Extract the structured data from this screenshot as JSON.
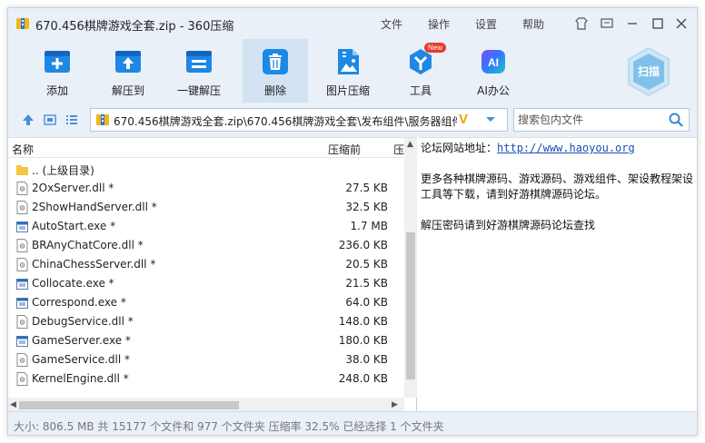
{
  "window": {
    "title": "670.456棋牌游戏全套.zip - 360压缩",
    "menus": [
      "文件",
      "操作",
      "设置",
      "帮助"
    ]
  },
  "toolbar": {
    "items": [
      {
        "label": "添加",
        "icon": "add-icon"
      },
      {
        "label": "解压到",
        "icon": "extract-to-icon"
      },
      {
        "label": "一键解压",
        "icon": "one-click-extract-icon"
      },
      {
        "label": "删除",
        "icon": "delete-icon"
      },
      {
        "label": "图片压缩",
        "icon": "image-compress-icon"
      },
      {
        "label": "工具",
        "icon": "tools-icon",
        "badge": "New"
      },
      {
        "label": "AI办公",
        "icon": "ai-office-icon"
      }
    ],
    "scan_label": "扫描"
  },
  "address": {
    "path": "670.456棋牌游戏全套.zip\\670.456棋牌游戏全套\\发布组件\\服务器组件\\F",
    "search_placeholder": "搜索包内文件"
  },
  "list": {
    "columns": {
      "name": "名称",
      "size": "压缩前",
      "packed": "压"
    },
    "rows": [
      {
        "name": ".. (上级目录)",
        "size": "",
        "type": "folder"
      },
      {
        "name": "2OxServer.dll *",
        "size": "27.5 KB",
        "type": "dll"
      },
      {
        "name": "2ShowHandServer.dll *",
        "size": "32.5 KB",
        "type": "dll"
      },
      {
        "name": "AutoStart.exe *",
        "size": "1.7 MB",
        "type": "exe"
      },
      {
        "name": "BRAnyChatCore.dll *",
        "size": "236.0 KB",
        "type": "dll"
      },
      {
        "name": "ChinaChessServer.dll *",
        "size": "20.5 KB",
        "type": "dll"
      },
      {
        "name": "Collocate.exe *",
        "size": "21.5 KB",
        "type": "exe"
      },
      {
        "name": "Correspond.exe *",
        "size": "64.0 KB",
        "type": "exe"
      },
      {
        "name": "DebugService.dll *",
        "size": "148.0 KB",
        "type": "dll"
      },
      {
        "name": "GameServer.exe *",
        "size": "180.0 KB",
        "type": "exe"
      },
      {
        "name": "GameService.dll *",
        "size": "38.0 KB",
        "type": "dll"
      },
      {
        "name": "KernelEngine.dll *",
        "size": "248.0 KB",
        "type": "dll"
      }
    ]
  },
  "comment": {
    "line1_label": "论坛网站地址：",
    "line1_link": "http://www.haoyou.org",
    "line2": "更多各种棋牌源码、游戏源码、游戏组件、架设教程架设工具等下载，请到好游棋牌源码论坛。",
    "line3": "解压密码请到好游棋牌源码论坛查找"
  },
  "status": {
    "text": "大小: 806.5 MB 共 15177 个文件和 977 个文件夹 压缩率 32.5% 已经选择 1 个文件夹"
  },
  "colors": {
    "accent": "#1e88e5",
    "chrome_bg": "#e9f0f7",
    "active_tool": "#d3e3f3",
    "link": "#1a4fb3"
  }
}
